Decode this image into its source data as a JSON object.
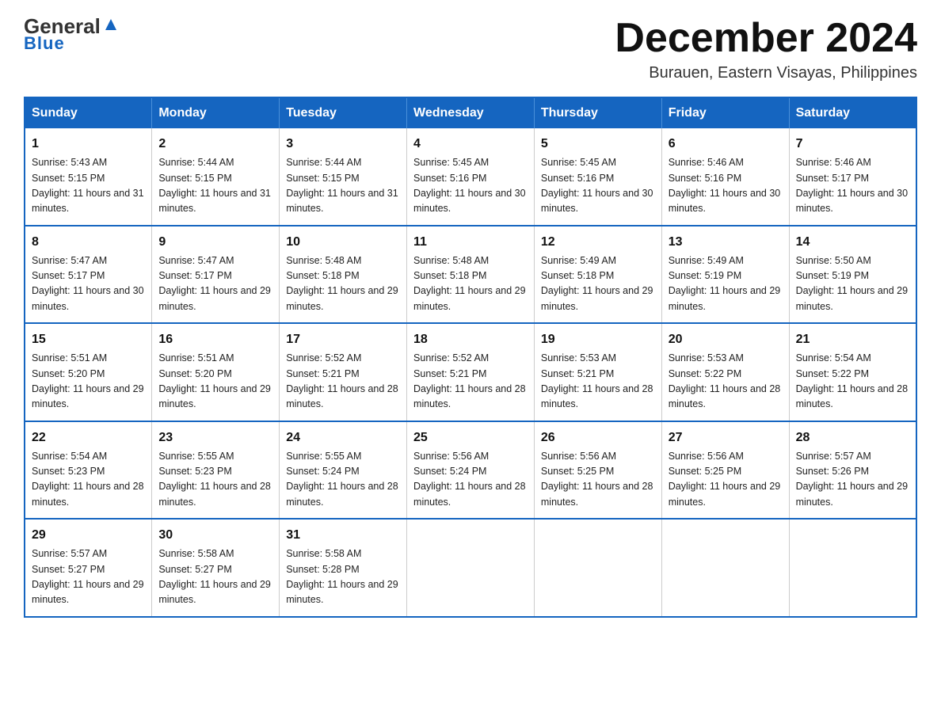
{
  "header": {
    "logo_general": "General",
    "logo_blue": "Blue",
    "month_title": "December 2024",
    "location": "Burauen, Eastern Visayas, Philippines"
  },
  "weekdays": [
    "Sunday",
    "Monday",
    "Tuesday",
    "Wednesday",
    "Thursday",
    "Friday",
    "Saturday"
  ],
  "weeks": [
    [
      {
        "day": "1",
        "sunrise": "5:43 AM",
        "sunset": "5:15 PM",
        "daylight": "11 hours and 31 minutes."
      },
      {
        "day": "2",
        "sunrise": "5:44 AM",
        "sunset": "5:15 PM",
        "daylight": "11 hours and 31 minutes."
      },
      {
        "day": "3",
        "sunrise": "5:44 AM",
        "sunset": "5:15 PM",
        "daylight": "11 hours and 31 minutes."
      },
      {
        "day": "4",
        "sunrise": "5:45 AM",
        "sunset": "5:16 PM",
        "daylight": "11 hours and 30 minutes."
      },
      {
        "day": "5",
        "sunrise": "5:45 AM",
        "sunset": "5:16 PM",
        "daylight": "11 hours and 30 minutes."
      },
      {
        "day": "6",
        "sunrise": "5:46 AM",
        "sunset": "5:16 PM",
        "daylight": "11 hours and 30 minutes."
      },
      {
        "day": "7",
        "sunrise": "5:46 AM",
        "sunset": "5:17 PM",
        "daylight": "11 hours and 30 minutes."
      }
    ],
    [
      {
        "day": "8",
        "sunrise": "5:47 AM",
        "sunset": "5:17 PM",
        "daylight": "11 hours and 30 minutes."
      },
      {
        "day": "9",
        "sunrise": "5:47 AM",
        "sunset": "5:17 PM",
        "daylight": "11 hours and 29 minutes."
      },
      {
        "day": "10",
        "sunrise": "5:48 AM",
        "sunset": "5:18 PM",
        "daylight": "11 hours and 29 minutes."
      },
      {
        "day": "11",
        "sunrise": "5:48 AM",
        "sunset": "5:18 PM",
        "daylight": "11 hours and 29 minutes."
      },
      {
        "day": "12",
        "sunrise": "5:49 AM",
        "sunset": "5:18 PM",
        "daylight": "11 hours and 29 minutes."
      },
      {
        "day": "13",
        "sunrise": "5:49 AM",
        "sunset": "5:19 PM",
        "daylight": "11 hours and 29 minutes."
      },
      {
        "day": "14",
        "sunrise": "5:50 AM",
        "sunset": "5:19 PM",
        "daylight": "11 hours and 29 minutes."
      }
    ],
    [
      {
        "day": "15",
        "sunrise": "5:51 AM",
        "sunset": "5:20 PM",
        "daylight": "11 hours and 29 minutes."
      },
      {
        "day": "16",
        "sunrise": "5:51 AM",
        "sunset": "5:20 PM",
        "daylight": "11 hours and 29 minutes."
      },
      {
        "day": "17",
        "sunrise": "5:52 AM",
        "sunset": "5:21 PM",
        "daylight": "11 hours and 28 minutes."
      },
      {
        "day": "18",
        "sunrise": "5:52 AM",
        "sunset": "5:21 PM",
        "daylight": "11 hours and 28 minutes."
      },
      {
        "day": "19",
        "sunrise": "5:53 AM",
        "sunset": "5:21 PM",
        "daylight": "11 hours and 28 minutes."
      },
      {
        "day": "20",
        "sunrise": "5:53 AM",
        "sunset": "5:22 PM",
        "daylight": "11 hours and 28 minutes."
      },
      {
        "day": "21",
        "sunrise": "5:54 AM",
        "sunset": "5:22 PM",
        "daylight": "11 hours and 28 minutes."
      }
    ],
    [
      {
        "day": "22",
        "sunrise": "5:54 AM",
        "sunset": "5:23 PM",
        "daylight": "11 hours and 28 minutes."
      },
      {
        "day": "23",
        "sunrise": "5:55 AM",
        "sunset": "5:23 PM",
        "daylight": "11 hours and 28 minutes."
      },
      {
        "day": "24",
        "sunrise": "5:55 AM",
        "sunset": "5:24 PM",
        "daylight": "11 hours and 28 minutes."
      },
      {
        "day": "25",
        "sunrise": "5:56 AM",
        "sunset": "5:24 PM",
        "daylight": "11 hours and 28 minutes."
      },
      {
        "day": "26",
        "sunrise": "5:56 AM",
        "sunset": "5:25 PM",
        "daylight": "11 hours and 28 minutes."
      },
      {
        "day": "27",
        "sunrise": "5:56 AM",
        "sunset": "5:25 PM",
        "daylight": "11 hours and 29 minutes."
      },
      {
        "day": "28",
        "sunrise": "5:57 AM",
        "sunset": "5:26 PM",
        "daylight": "11 hours and 29 minutes."
      }
    ],
    [
      {
        "day": "29",
        "sunrise": "5:57 AM",
        "sunset": "5:27 PM",
        "daylight": "11 hours and 29 minutes."
      },
      {
        "day": "30",
        "sunrise": "5:58 AM",
        "sunset": "5:27 PM",
        "daylight": "11 hours and 29 minutes."
      },
      {
        "day": "31",
        "sunrise": "5:58 AM",
        "sunset": "5:28 PM",
        "daylight": "11 hours and 29 minutes."
      },
      {
        "day": "",
        "sunrise": "",
        "sunset": "",
        "daylight": ""
      },
      {
        "day": "",
        "sunrise": "",
        "sunset": "",
        "daylight": ""
      },
      {
        "day": "",
        "sunrise": "",
        "sunset": "",
        "daylight": ""
      },
      {
        "day": "",
        "sunrise": "",
        "sunset": "",
        "daylight": ""
      }
    ]
  ]
}
